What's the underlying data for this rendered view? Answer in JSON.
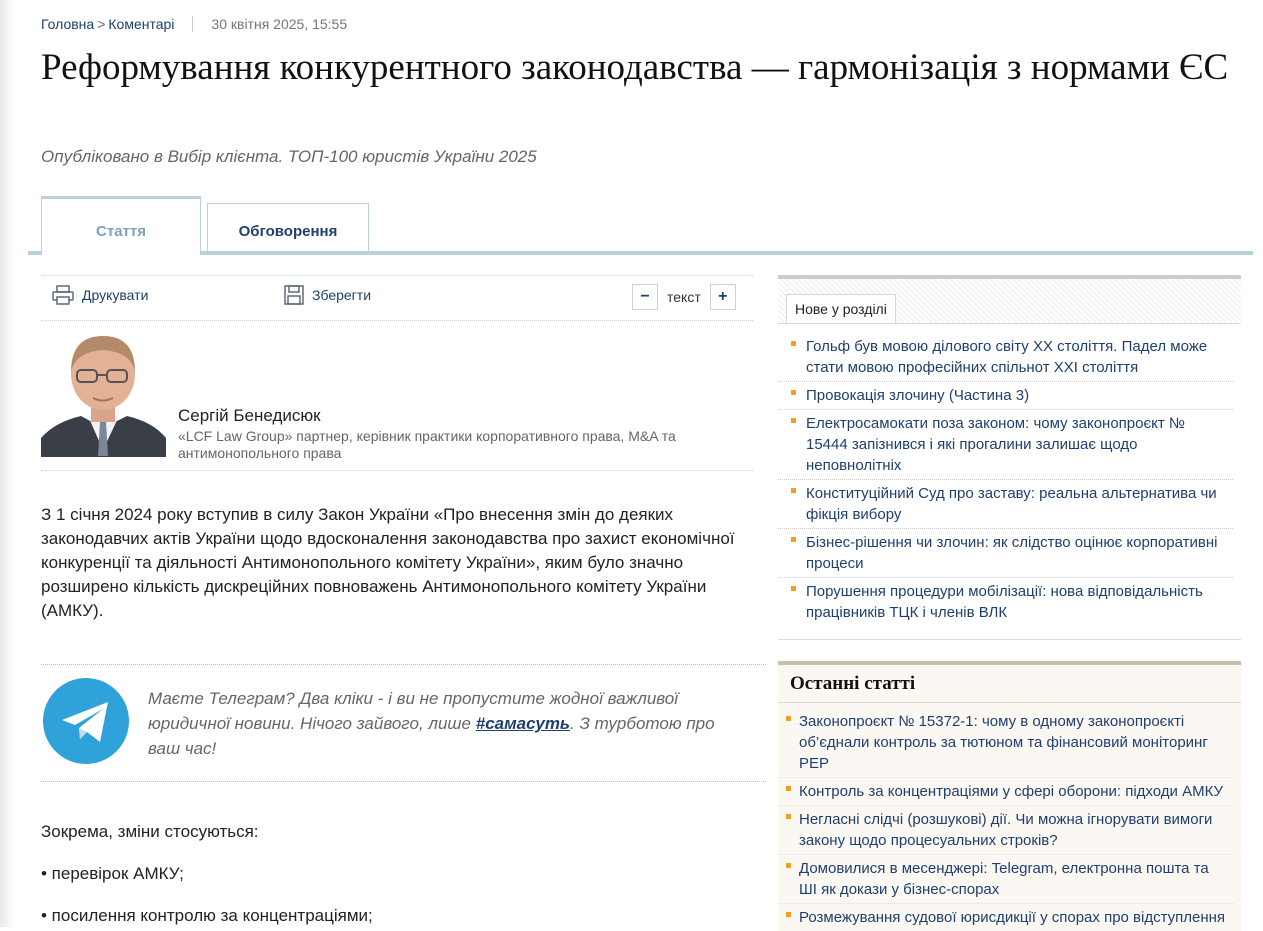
{
  "breadcrumb": {
    "home": "Головна",
    "separator": ">",
    "section": "Коментарі",
    "date": "30 квітня 2025, 15:55"
  },
  "article": {
    "title": "Реформування конкурентного законодавства — гармонізація з нормами ЄС",
    "published": "Опубліковано в Вибір клієнта. ТОП-100 юристів України 2025",
    "tabs": [
      {
        "label": "Стаття"
      },
      {
        "label": "Обговорення"
      }
    ],
    "toolbar": {
      "print": "Друкувати",
      "save": "Зберегти",
      "minus": "−",
      "text": "текст",
      "plus": "+"
    },
    "author": {
      "name": "Сергій Бенедисюк",
      "role": "«LCF Law Group» партнер, керівник практики корпоративного права, M&A та антимонопольного права"
    },
    "intro": "З 1 січня 2024 року вступив в силу Закон України «Про внесення змін до деяких законодавчих актів України щодо вдосконалення законодавства про захист економічної конкуренції та діяльності Антимонопольного комітету України», яким було значно розширено кількість дискреційних повноважень Антимонопольного комітету України (АМКУ).",
    "telegram": {
      "text_before": "Маєте Телеграм? Два кліки - і ви не пропустите жодної важливої юридичної новини. Нічого зайвого, лише ",
      "hashtag": "#самасуть",
      "text_after": ". З турботою про ваш час!"
    },
    "body": [
      "Зокрема, зміни стосуються:",
      "• перевірок АМКУ;",
      "• посилення контролю за концентраціями;"
    ]
  },
  "sidebar": {
    "new_in_section": {
      "tab": "Нове у розділі",
      "items": [
        "Гольф був мовою ділового світу ХХ століття. Падел може стати мовою професійних спільнот ХХІ століття",
        "Провокація злочину (Частина 3)",
        "Електросамокати поза законом: чому законопроєкт № 15444 запізнився і які прогалини залишає щодо неповнолітніх",
        "Конституційний Суд про заставу: реальна альтернатива чи фікція вибору",
        "Бізнес-рішення чи злочин: як слідство оцінює корпоративні процеси",
        "Порушення процедури мобілізації: нова відповідальність працівників ТЦК і членів ВЛК"
      ]
    },
    "latest": {
      "title": "Останні статті",
      "items": [
        "Законопроєкт № 15372-1: чому в одному законопроєкті об’єднали контроль за тютюном та фінансовий моніторинг PEP",
        "Контроль за концентраціями у сфері оборони: підходи АМКУ",
        "Негласні слідчі (розшукові) дії. Чи можна ігнорувати вимоги закону щодо процесуальних строків?",
        "Домовилися в месенджері: Telegram, електронна пошта та ШІ як докази у бізнес-спорах",
        "Розмежування судової юрисдикції у спорах про відступлення"
      ]
    }
  },
  "colors": {
    "link": "#1f3f6e",
    "tab_border": "#b9d0dd",
    "bullet": "#f0a01e",
    "telegram": "#2fa2d9"
  }
}
